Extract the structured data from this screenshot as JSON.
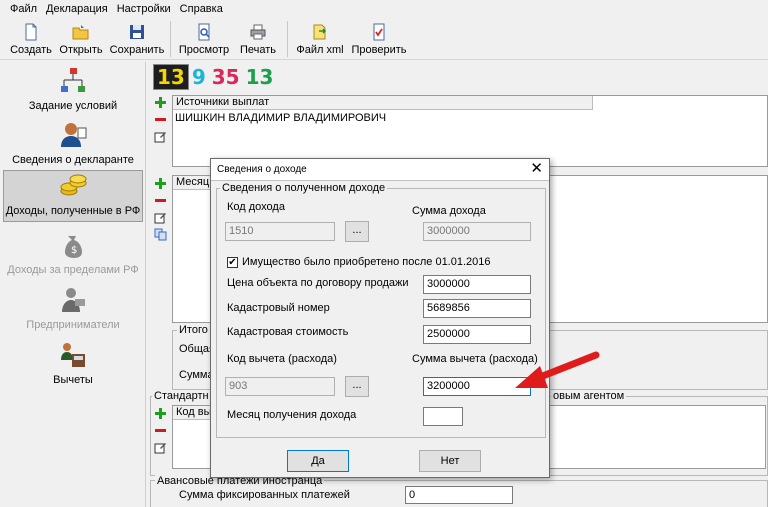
{
  "menu": [
    "Файл",
    "Декларация",
    "Настройки",
    "Справка"
  ],
  "toolbar": {
    "create": "Создать",
    "open": "Открыть",
    "save": "Сохранить",
    "preview": "Просмотр",
    "print": "Печать",
    "file_xml": "Файл xml",
    "check": "Проверить"
  },
  "nav": {
    "conditions": "Задание условий",
    "declarant": "Сведения о декларанте",
    "income_rf": "Доходы, полученные в РФ",
    "income_abroad": "Доходы за пределами РФ",
    "entrepreneurs": "Предприниматели",
    "deductions": "Вычеты"
  },
  "rate_tabs": [
    "13",
    "9",
    "35",
    "13"
  ],
  "sources": {
    "header": "Источники выплат",
    "rows": [
      "ШИШКИН ВЛАДИМИР ВЛАДИМИРОВИЧ"
    ]
  },
  "months": {
    "header_partial": "Месяц"
  },
  "totals": {
    "title_partial": "Итого",
    "total_partial": "Общая",
    "sum_partial": "Сумма"
  },
  "standard": {
    "title_partial": "Стандартн",
    "title_tail_partial": "овым агентом",
    "header_partial": "Код вы"
  },
  "advance": {
    "title": "Авансовые платежи иностранца",
    "fixed_label": "Сумма фиксированных платежей",
    "fixed_value": "0"
  },
  "dialog": {
    "title": "Сведения о доходе",
    "close": "✕",
    "group": "Сведения о полученном доходе",
    "income_code_label": "Код дохода",
    "income_code": "1510",
    "income_sum_label": "Сумма дохода",
    "income_sum": "3000000",
    "ellipsis": "...",
    "checkbox_label": "Имущество было приобретено после 01.01.2016",
    "checkbox_mark": "✔",
    "price_label": "Цена объекта по договору продажи",
    "price": "3000000",
    "cadastral_number_label": "Кадастровый номер",
    "cadastral_number": "5689856",
    "cadastral_cost_label": "Кадастровая стоимость",
    "cadastral_cost": "2500000",
    "deduction_code_label": "Код вычета (расхода)",
    "deduction_code": "903",
    "deduction_sum_label": "Сумма вычета (расхода)",
    "deduction_sum": "3200000",
    "month_label": "Месяц получения дохода",
    "month_value": "",
    "ok": "Да",
    "cancel": "Нет"
  },
  "colors": {
    "arrow": "#e01b1b",
    "accent": "#0078d7"
  }
}
